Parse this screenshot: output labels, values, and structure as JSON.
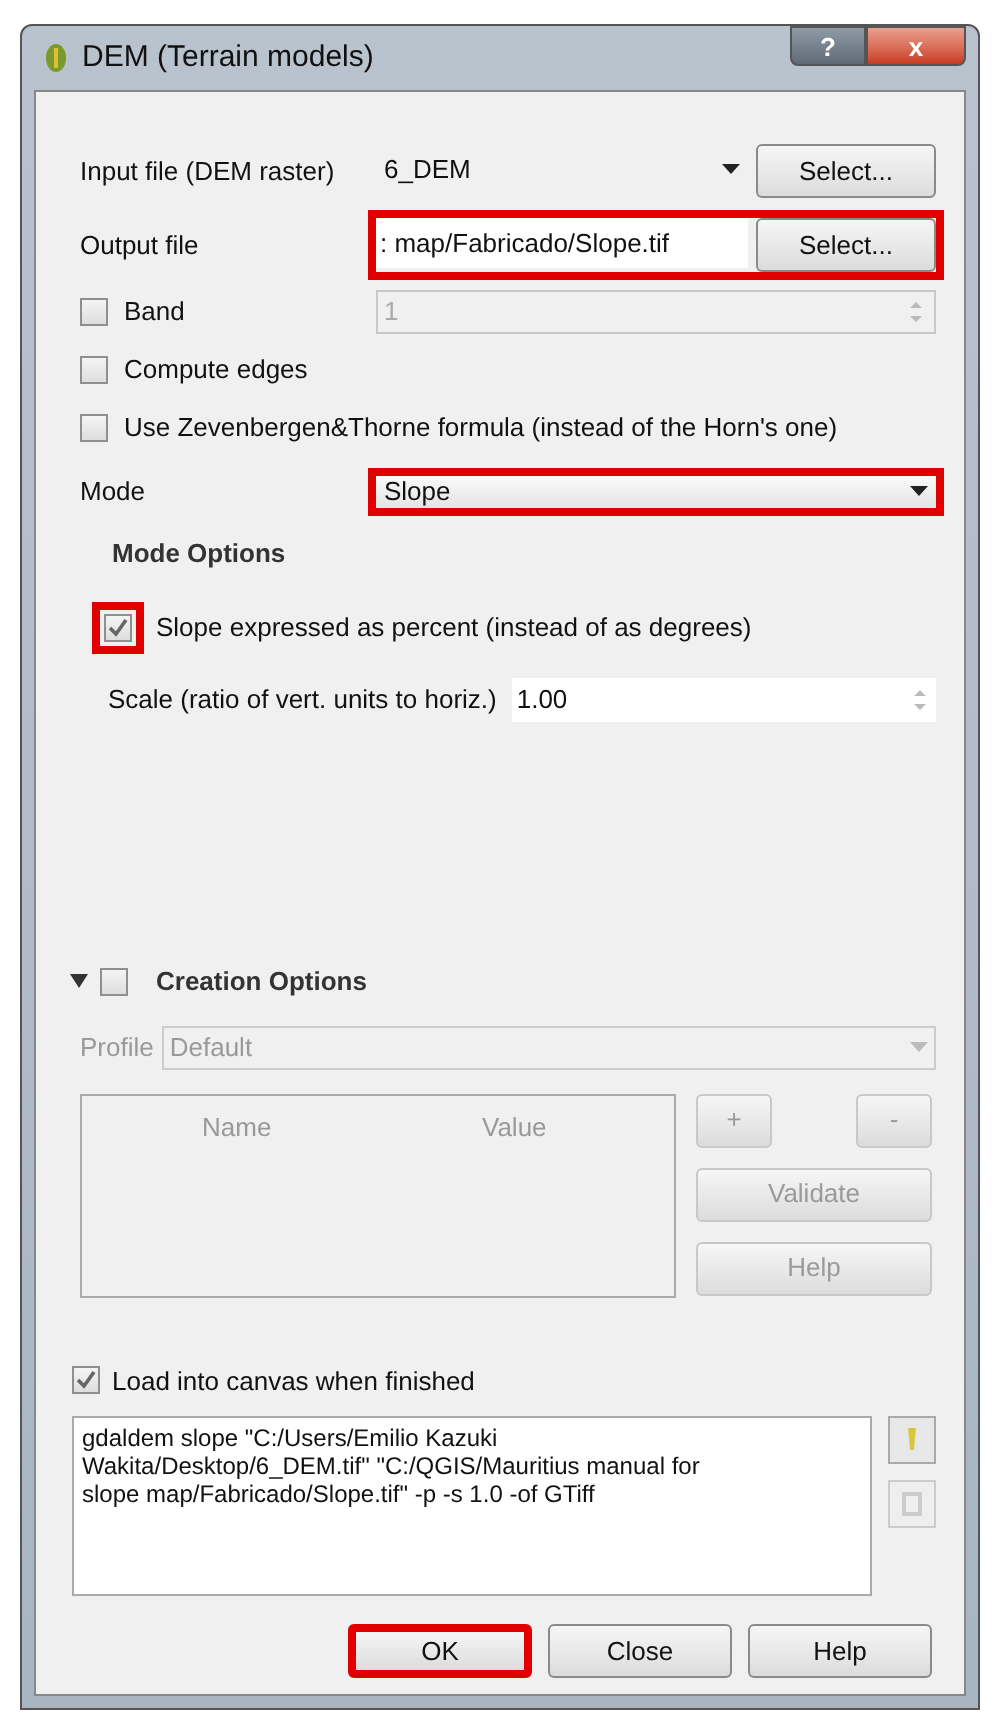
{
  "window": {
    "title": "DEM (Terrain models)",
    "help_button": "?",
    "close_button": "x"
  },
  "input_file": {
    "label": "Input file (DEM raster)",
    "value": "6_DEM",
    "button": "Select...",
    "highlighted": false
  },
  "output_file": {
    "label": "Output file",
    "value": ": map/Fabricado/Slope.tif",
    "button": "Select...",
    "highlighted": true
  },
  "band": {
    "label": "Band",
    "checked": false,
    "value": "1",
    "disabled": true
  },
  "options": [
    {
      "label": "Compute edges",
      "checked": false
    },
    {
      "label": "Use Zevenbergen&Thorne formula (instead of the Horn's one)",
      "checked": false
    }
  ],
  "mode": {
    "label": "Mode",
    "value": "Slope",
    "highlighted": true
  },
  "mode_options": {
    "title": "Mode Options",
    "percent": {
      "label": "Slope expressed as percent (instead of as degrees)",
      "checked": true,
      "highlighted": true
    },
    "scale": {
      "label": "Scale (ratio of vert. units to horiz.)",
      "value": "1.00"
    }
  },
  "creation_options": {
    "title": "Creation Options",
    "expanded": true,
    "checked": false,
    "profile_label": "Profile",
    "profile_value": "Default",
    "columns": [
      "Name",
      "Value"
    ],
    "buttons": [
      "+",
      "-",
      "Validate",
      "Help"
    ]
  },
  "load_into_canvas": {
    "label": "Load into canvas when finished",
    "checked": true
  },
  "command": {
    "lines": [
      "gdaldem slope \"C:/Users/Emilio Kazuki",
      "Wakita/Desktop/6_DEM.tif\" \"C:/QGIS/Mauritius manual for",
      "slope map/Fabricado/Slope.tif\" -p -s 1.0 -of GTiff"
    ]
  },
  "buttons": [
    {
      "label": "OK",
      "highlighted": true
    },
    {
      "label": "Close",
      "highlighted": false
    },
    {
      "label": "Help",
      "highlighted": false
    }
  ]
}
